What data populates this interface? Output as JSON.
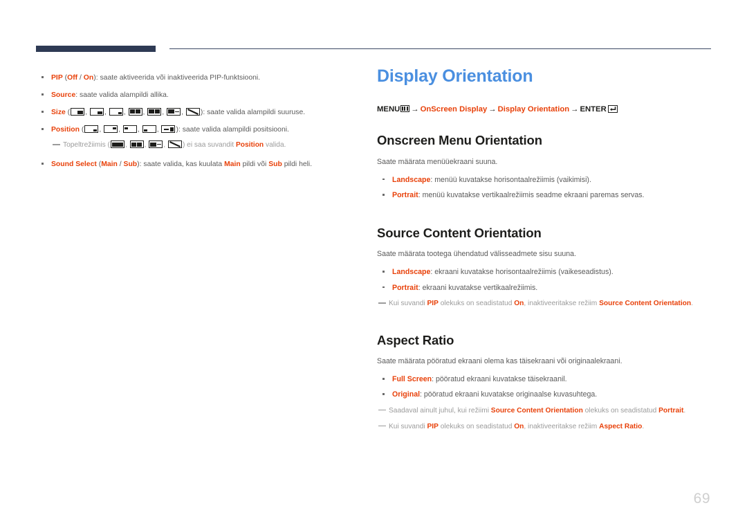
{
  "page": {
    "number": "69"
  },
  "left_column": {
    "bullets": [
      {
        "label": "PIP",
        "options_prefix": " (",
        "opt1": "Off",
        "opt_sep": " / ",
        "opt2": "On",
        "options_suffix": ")",
        "text": ": saate aktiveerida või inaktiveerida PIP-funktsiooni."
      },
      {
        "label": "Source",
        "text": ": saate valida alampildi allika."
      },
      {
        "label": "Size",
        "text": ": saate valida alampildi suuruse.",
        "icons": [
          "pip-size-large-icon",
          "pip-size-medium-icon",
          "pip-size-small-icon",
          "pip-split-half-icon",
          "pip-split-wide-icon",
          "pip-split-bar-icon",
          "pip-diagonal-icon"
        ]
      },
      {
        "label": "Position",
        "text": ": saate valida alampildi positsiooni.",
        "icons": [
          "pip-pos-bottom-right-icon",
          "pip-pos-top-right-icon",
          "pip-pos-top-left-icon",
          "pip-pos-bottom-left-icon",
          "pip-pos-arrow-icon"
        ]
      },
      {
        "label": "Sound Select",
        "options_prefix": " (",
        "opt1": "Main",
        "opt_sep": " / ",
        "opt2": "Sub",
        "options_suffix": ")",
        "text_a": ": saate valida, kas kuulata ",
        "em_a": "Main",
        "text_b": " pildi või ",
        "em_b": "Sub",
        "text_c": " pildi heli."
      }
    ],
    "note": {
      "text_a": "Topeltrežiimis (",
      "text_b": ") ei saa suvandit ",
      "em": "Position",
      "text_c": " valida.",
      "icons": [
        "pip-split-half-icon",
        "pip-split-wide-icon",
        "pip-split-bar-icon",
        "pip-diagonal-icon"
      ]
    }
  },
  "right_column": {
    "title": "Display Orientation",
    "menu_path": {
      "menu": "MENU",
      "menu_icon": "menu-glyph-icon",
      "arrow": "→",
      "step1": "OnScreen Display",
      "step2": "Display Orientation",
      "enter": "ENTER",
      "enter_icon": "enter-glyph-icon"
    },
    "sections": [
      {
        "heading": "Onscreen Menu Orientation",
        "lead": "Saate määrata menüüekraani suuna.",
        "bullets": [
          {
            "label": "Landscape",
            "text": ": menüü kuvatakse horisontaalrežiimis (vaikimisi)."
          },
          {
            "label": "Portrait",
            "text": ": menüü kuvatakse vertikaalrežiimis seadme ekraani paremas servas."
          }
        ],
        "notes": []
      },
      {
        "heading": "Source Content Orientation",
        "lead": "Saate määrata tootega ühendatud välisseadmete sisu suuna.",
        "bullets": [
          {
            "label": "Landscape",
            "text": ": ekraani kuvatakse horisontaalrežiimis (vaikeseadistus)."
          },
          {
            "label": "Portrait",
            "text": ": ekraani kuvatakse vertikaalrežiimis."
          }
        ],
        "notes": [
          {
            "t1": "Kui suvandi ",
            "e1": "PIP",
            "t2": " olekuks on seadistatud ",
            "e2": "On",
            "t3": ", inaktiveeritakse režiim ",
            "e3": "Source Content Orientation",
            "t4": "."
          }
        ]
      },
      {
        "heading": "Aspect Ratio",
        "lead": "Saate määrata pööratud ekraani olema kas täisekraani või originaalekraani.",
        "bullets": [
          {
            "label": "Full Screen",
            "text": ": pööratud ekraani kuvatakse täisekraanil."
          },
          {
            "label": "Original",
            "text": ": pööratud ekraani kuvatakse originaalse kuvasuhtega."
          }
        ],
        "notes": [
          {
            "t1": "Saadaval ainult juhul, kui režiimi ",
            "e1": "Source Content Orientation",
            "t2": " olekuks on seadistatud ",
            "e2": "Portrait",
            "t3": ".",
            "e3": "",
            "t4": ""
          },
          {
            "t1": "Kui suvandi ",
            "e1": "PIP",
            "t2": " olekuks on seadistatud ",
            "e2": "On",
            "t3": ", inaktiveeritakse režiim ",
            "e3": "Aspect Ratio",
            "t4": "."
          }
        ]
      }
    ]
  },
  "colors": {
    "accent": "#e8410a",
    "title_blue": "#4a8fe0",
    "rule_navy": "#2e3a54",
    "body_gray": "#5a5a5a",
    "note_gray": "#9b9b9b",
    "page_number_gray": "#cfcfcf"
  }
}
